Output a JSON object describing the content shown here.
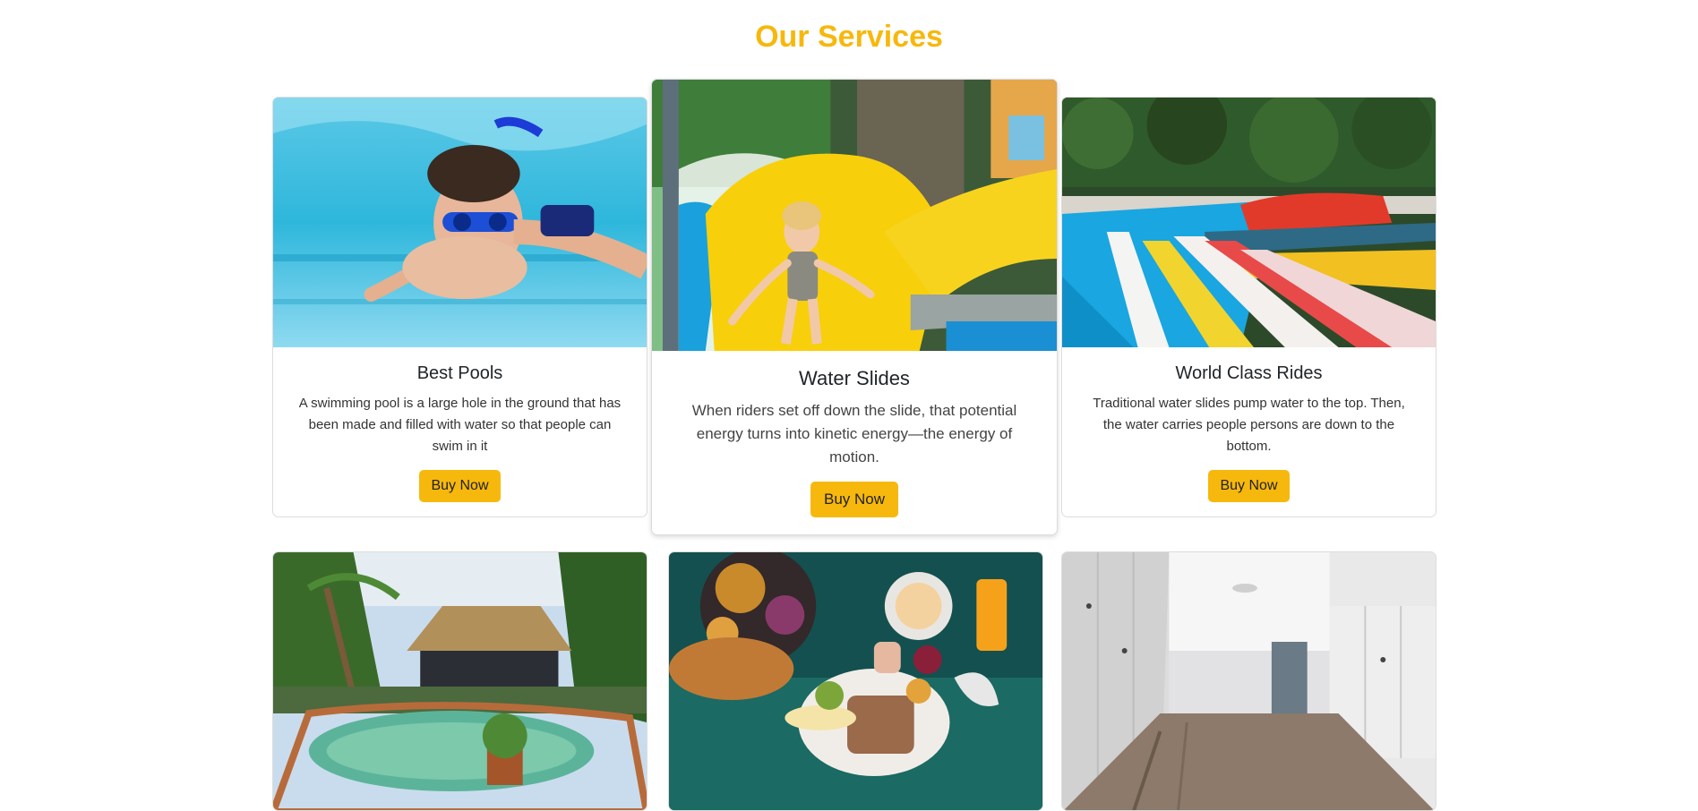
{
  "section": {
    "title": "Our Services"
  },
  "cards": [
    {
      "title": "Best Pools",
      "text": "A swimming pool is a large hole in the ground that has been made and filled with water so that people can swim in it",
      "button": "Buy Now",
      "image": "swimming-boy-photo"
    },
    {
      "title": "Water Slides",
      "text": "When riders set off down the slide, that potential energy turns into kinetic energy—the energy of motion.",
      "button": "Buy Now",
      "image": "yellow-slide-photo"
    },
    {
      "title": "World Class Rides",
      "text": "Traditional water slides pump water to the top. Then, the water carries people persons are down to the bottom.",
      "button": "Buy Now",
      "image": "pool-slides-photo"
    },
    {
      "image": "tropical-pool-hut-photo"
    },
    {
      "image": "breakfast-tray-photo"
    },
    {
      "image": "locker-room-photo"
    }
  ],
  "colors": {
    "accent": "#f7b80d"
  }
}
